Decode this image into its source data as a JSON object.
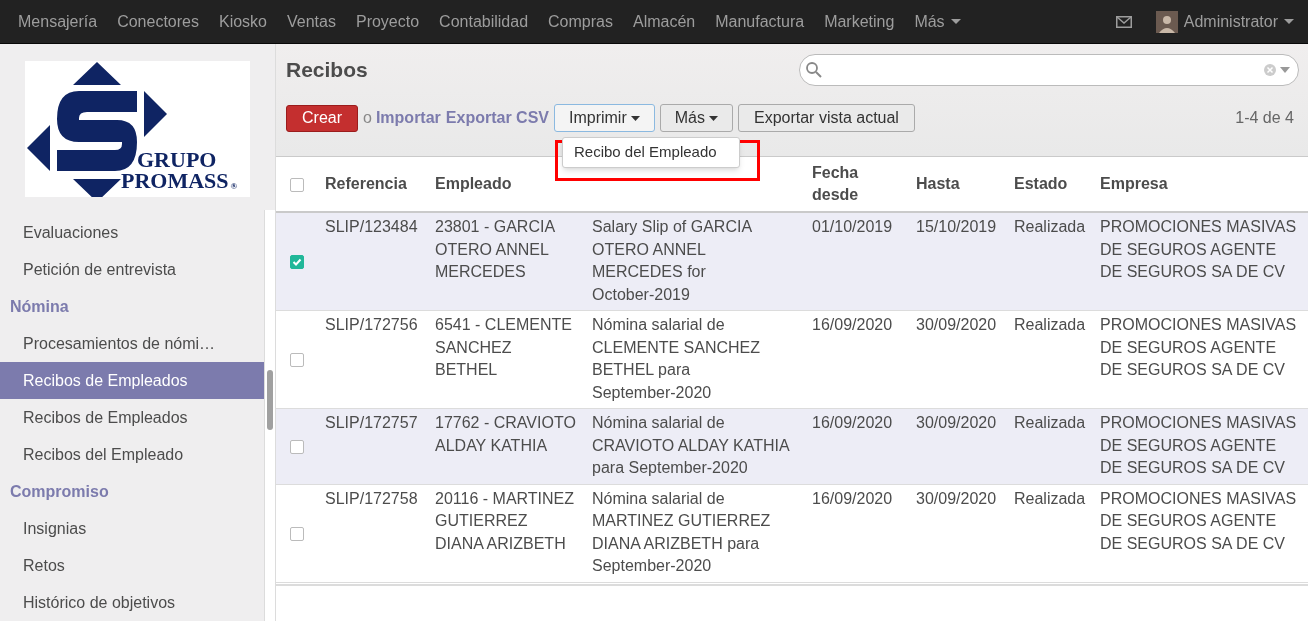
{
  "top_menu": [
    {
      "label": "Mensajería"
    },
    {
      "label": "Conectores"
    },
    {
      "label": "Kiosko"
    },
    {
      "label": "Ventas"
    },
    {
      "label": "Proyecto"
    },
    {
      "label": "Contabilidad"
    },
    {
      "label": "Compras"
    },
    {
      "label": "Almacén"
    },
    {
      "label": "Manufactura"
    },
    {
      "label": "Marketing"
    },
    {
      "label": "Más"
    }
  ],
  "user": {
    "name": "Administrator"
  },
  "logo": {
    "line1": "GRUPO",
    "line2": "PROMASS",
    "mark": "®"
  },
  "sidebar": [
    {
      "kind": "item",
      "label": "Evaluaciones",
      "selected": false
    },
    {
      "kind": "item",
      "label": "Petición de entrevista",
      "selected": false
    },
    {
      "kind": "section",
      "label": "Nómina"
    },
    {
      "kind": "item",
      "label": "Procesamientos de nómi…",
      "selected": false
    },
    {
      "kind": "item",
      "label": "Recibos de Empleados",
      "selected": true
    },
    {
      "kind": "item",
      "label": "Recibos de Empleados",
      "selected": false
    },
    {
      "kind": "item",
      "label": "Recibos del Empleado",
      "selected": false
    },
    {
      "kind": "section",
      "label": "Compromiso"
    },
    {
      "kind": "item",
      "label": "Insignias",
      "selected": false
    },
    {
      "kind": "item",
      "label": "Retos",
      "selected": false
    },
    {
      "kind": "item",
      "label": "Histórico de objetivos",
      "selected": false
    }
  ],
  "page_title": "Recibos",
  "toolbar": {
    "create": "Crear",
    "or": "o",
    "import_link": "Importar",
    "export_link": "Exportar CSV",
    "print": "Imprimir",
    "more": "Más",
    "export_view": "Exportar vista actual",
    "pager": "1-4 de 4"
  },
  "print_menu": {
    "items": [
      "Recibo del Empleado"
    ],
    "highlighted": true
  },
  "table": {
    "all_selected": false,
    "columns": [
      "Referencia",
      "Empleado",
      null,
      "Fecha desde",
      "Hasta",
      "Estado",
      "Empresa"
    ],
    "rows": [
      {
        "selected": true,
        "cells": [
          "SLIP/123484",
          "23801 - GARCIA OTERO ANNEL MERCEDES",
          "Salary Slip of GARCIA OTERO ANNEL MERCEDES for October-2019",
          "01/10/2019",
          "15/10/2019",
          "Realizada",
          "PROMOCIONES MASIVAS DE SEGUROS AGENTE DE SEGUROS SA DE CV"
        ]
      },
      {
        "selected": false,
        "cells": [
          "SLIP/172756",
          "6541 - CLEMENTE SANCHEZ BETHEL",
          "Nómina salarial de CLEMENTE SANCHEZ BETHEL para September-2020",
          "16/09/2020",
          "30/09/2020",
          "Realizada",
          "PROMOCIONES MASIVAS DE SEGUROS AGENTE DE SEGUROS SA DE CV"
        ]
      },
      {
        "selected": false,
        "cells": [
          "SLIP/172757",
          "17762 - CRAVIOTO ALDAY KATHIA",
          "Nómina salarial de CRAVIOTO ALDAY KATHIA para September-2020",
          "16/09/2020",
          "30/09/2020",
          "Realizada",
          "PROMOCIONES MASIVAS DE SEGUROS AGENTE DE SEGUROS SA DE CV"
        ]
      },
      {
        "selected": false,
        "cells": [
          "SLIP/172758",
          "20116 - MARTINEZ GUTIERREZ DIANA ARIZBETH",
          "Nómina salarial de MARTINEZ GUTIERREZ DIANA ARIZBETH para September-2020",
          "16/09/2020",
          "30/09/2020",
          "Realizada",
          "PROMOCIONES MASIVAS DE SEGUROS AGENTE DE SEGUROS SA DE CV"
        ]
      }
    ]
  }
}
